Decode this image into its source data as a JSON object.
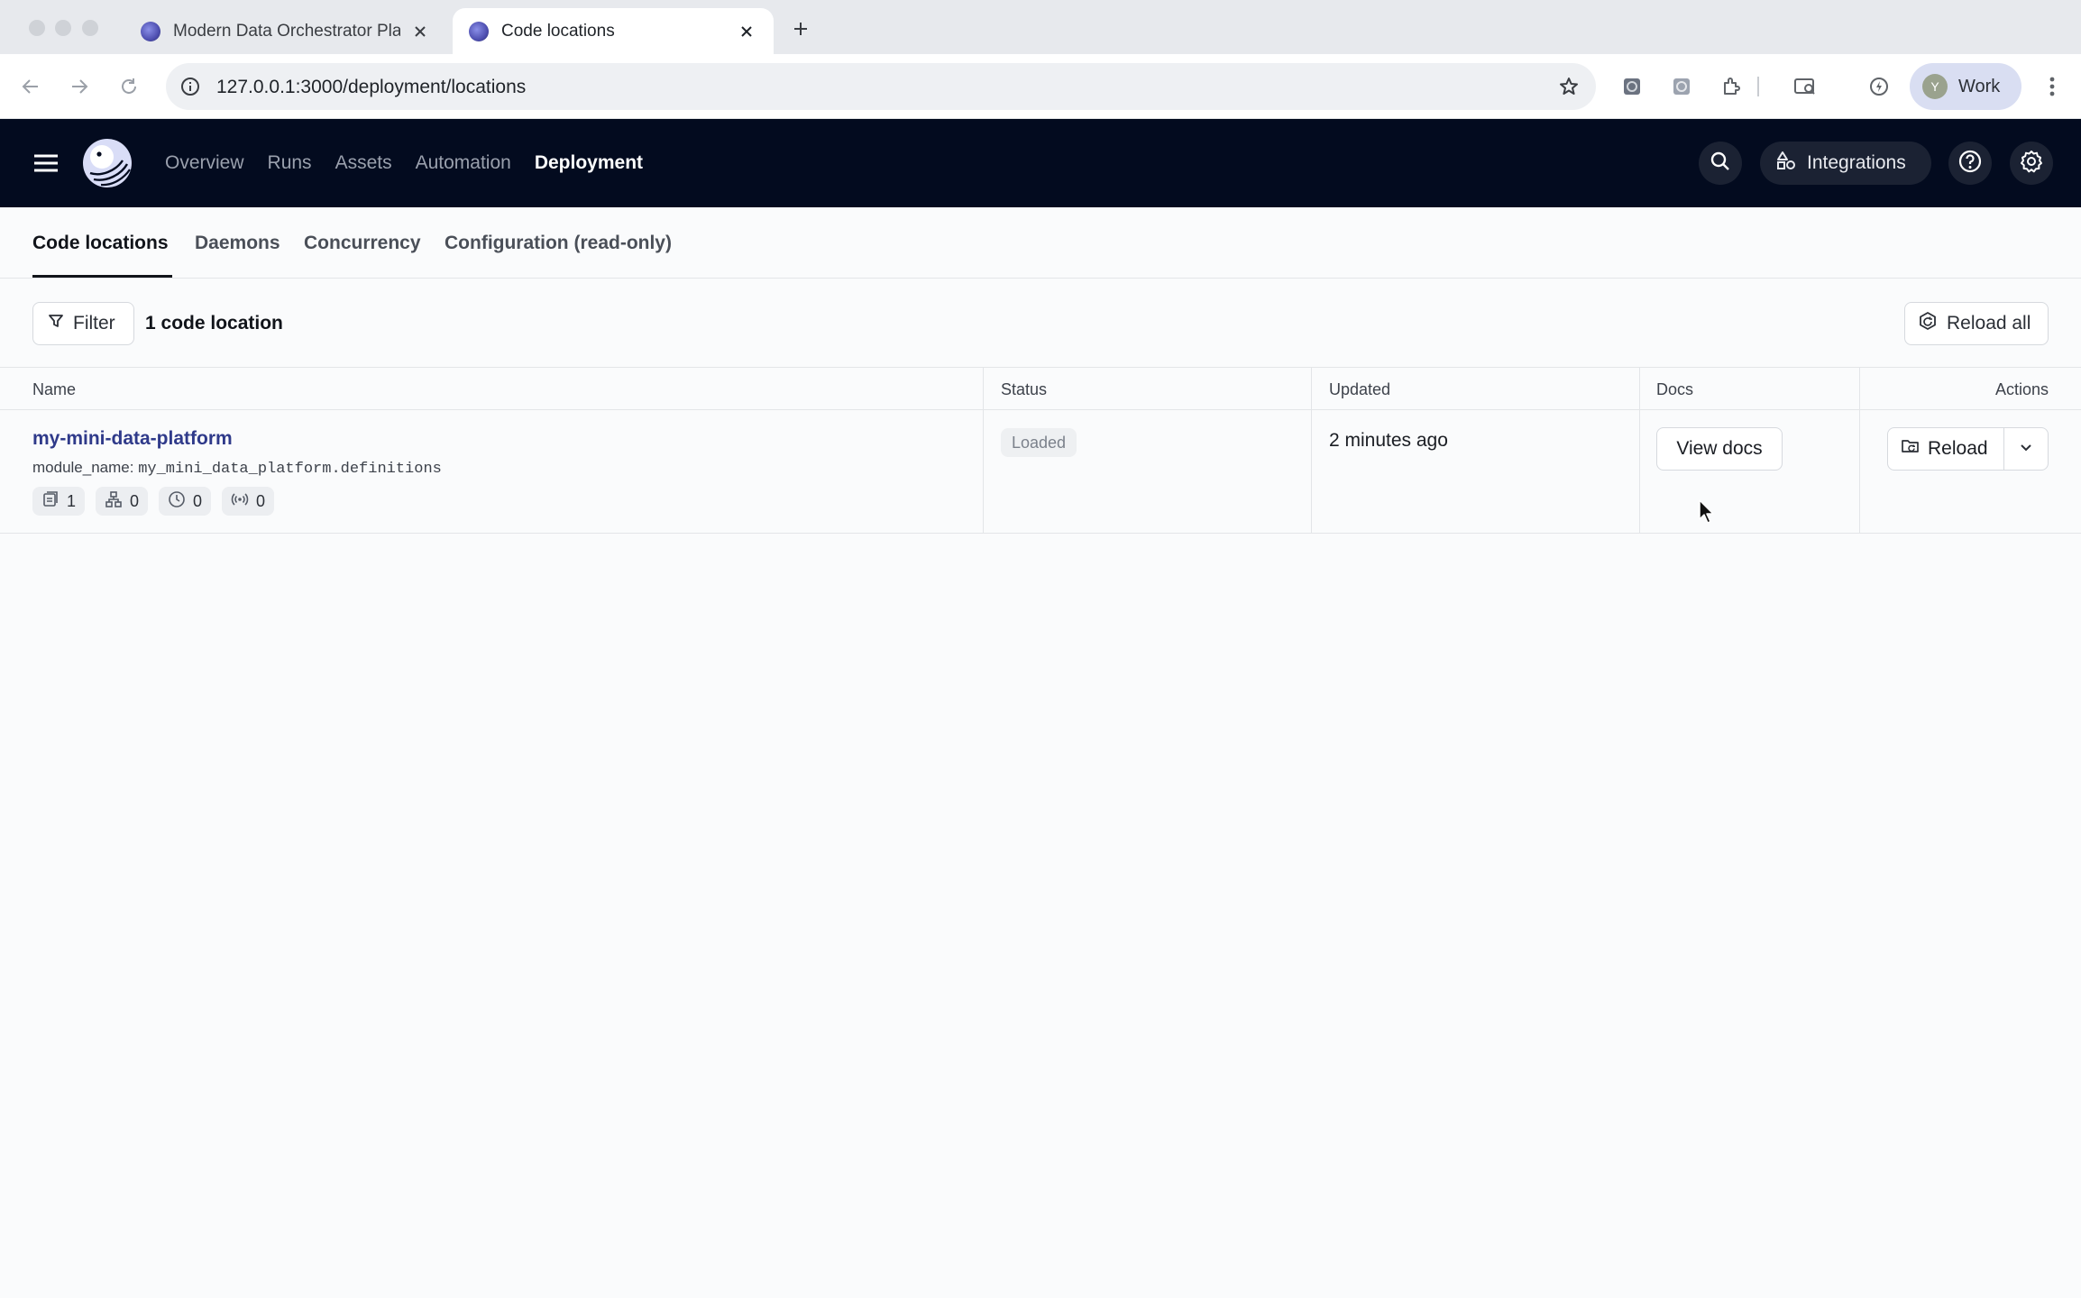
{
  "browser": {
    "tabs": [
      {
        "title": "Modern Data Orchestrator Pla",
        "active": false
      },
      {
        "title": "Code locations",
        "active": true
      }
    ],
    "url": "127.0.0.1:3000/deployment/locations",
    "profile_label": "Work",
    "profile_initial": "Y"
  },
  "app_nav": {
    "links": [
      "Overview",
      "Runs",
      "Assets",
      "Automation",
      "Deployment"
    ],
    "active": "Deployment",
    "integrations_label": "Integrations"
  },
  "subtabs": {
    "items": [
      "Code locations",
      "Daemons",
      "Concurrency",
      "Configuration (read-only)"
    ],
    "active": "Code locations"
  },
  "toolbar": {
    "filter_label": "Filter",
    "count_label": "1 code location",
    "reload_all_label": "Reload all"
  },
  "table": {
    "columns": [
      "Name",
      "Status",
      "Updated",
      "Docs",
      "Actions"
    ],
    "rows": [
      {
        "name": "my-mini-data-platform",
        "module_label": "module_name:",
        "module_value": "my_mini_data_platform.definitions",
        "chips": [
          {
            "icon": "job-icon",
            "count": "1"
          },
          {
            "icon": "asset-graph-icon",
            "count": "0"
          },
          {
            "icon": "schedule-icon",
            "count": "0"
          },
          {
            "icon": "sensor-icon",
            "count": "0"
          }
        ],
        "status": "Loaded",
        "updated": "2 minutes ago",
        "docs_label": "View docs",
        "action_label": "Reload"
      }
    ]
  },
  "colors": {
    "nav_bg": "#030b1f",
    "link_accent": "#2f3a8a"
  }
}
